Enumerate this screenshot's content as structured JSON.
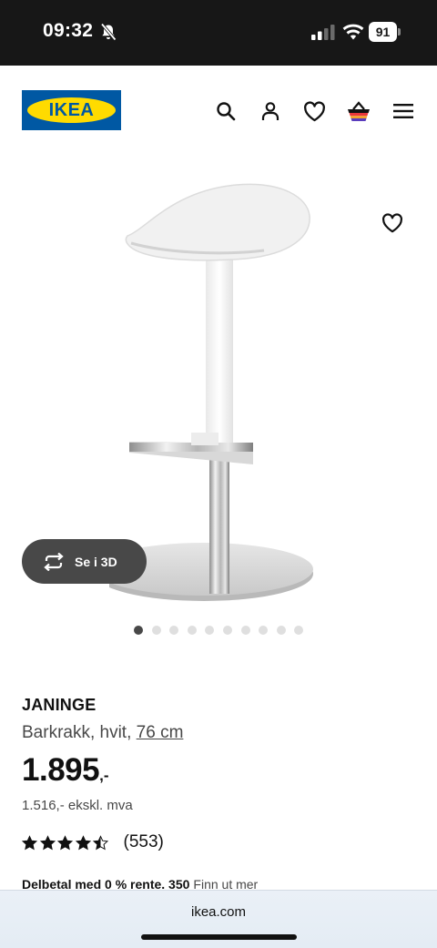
{
  "status_bar": {
    "time": "09:32",
    "battery": "91",
    "icons": [
      "bell-slash-icon",
      "cellular-signal-icon",
      "wifi-icon",
      "battery-icon"
    ]
  },
  "header": {
    "logo_text": "IKEA",
    "icons": [
      "search-icon",
      "profile-icon",
      "heart-icon",
      "shopping-bag-icon",
      "hamburger-menu-icon"
    ],
    "colors": {
      "logo_blue": "#0058a3",
      "logo_yellow": "#ffdb00"
    }
  },
  "gallery": {
    "view_3d_label": "Se i 3D",
    "image_count": 10,
    "active_index": 0
  },
  "product": {
    "name": "JANINGE",
    "description_prefix": "Barkrakk, hvit, ",
    "size_link": "76 cm",
    "price_integer": "1.895",
    "price_suffix": ",-",
    "price_excl_vat": "1.516,- ekskl. mva",
    "rating": 4.5,
    "rating_max": 5,
    "review_count": "(553)",
    "installment_bold": "Delbetal med 0 % rente. 350",
    "installment_more": "Finn ut mer"
  },
  "browser": {
    "url": "ikea.com"
  }
}
